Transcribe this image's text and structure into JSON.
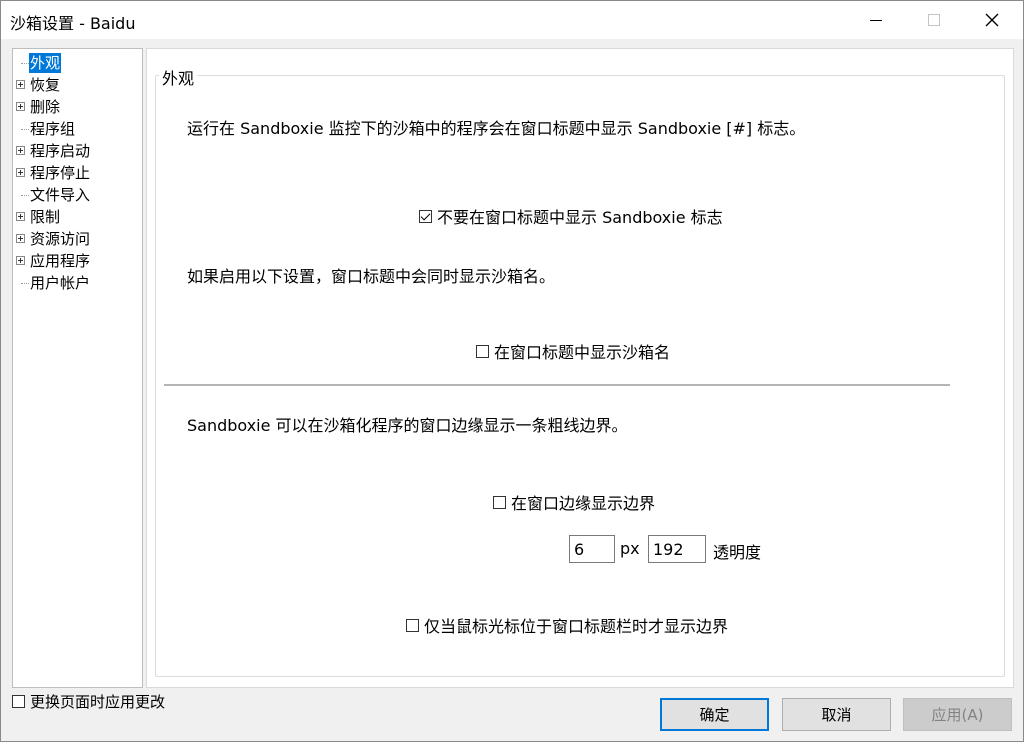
{
  "window": {
    "title": "沙箱设置 - Baidu"
  },
  "tree": {
    "items": [
      {
        "label": "外观",
        "expandable": false,
        "selected": true
      },
      {
        "label": "恢复",
        "expandable": true,
        "selected": false
      },
      {
        "label": "删除",
        "expandable": true,
        "selected": false
      },
      {
        "label": "程序组",
        "expandable": false,
        "selected": false
      },
      {
        "label": "程序启动",
        "expandable": true,
        "selected": false
      },
      {
        "label": "程序停止",
        "expandable": true,
        "selected": false
      },
      {
        "label": "文件导入",
        "expandable": false,
        "selected": false
      },
      {
        "label": "限制",
        "expandable": true,
        "selected": false
      },
      {
        "label": "资源访问",
        "expandable": true,
        "selected": false
      },
      {
        "label": "应用程序",
        "expandable": true,
        "selected": false
      },
      {
        "label": "用户帐户",
        "expandable": false,
        "selected": false
      }
    ]
  },
  "panel": {
    "group_title": "外观",
    "desc_title_marker": "运行在 Sandboxie 监控下的沙箱中的程序会在窗口标题中显示 Sandboxie [#] 标志。",
    "chk_hide_marker": {
      "label": "不要在窗口标题中显示 Sandboxie 标志",
      "checked": true
    },
    "desc_box_name": "如果启用以下设置，窗口标题中会同时显示沙箱名。",
    "chk_show_box_name": {
      "label": "在窗口标题中显示沙箱名",
      "checked": false
    },
    "desc_border": "Sandboxie 可以在沙箱化程序的窗口边缘显示一条粗线边界。",
    "chk_show_border": {
      "label": "在窗口边缘显示边界",
      "checked": false
    },
    "border_width": "6",
    "border_width_unit": "px",
    "opacity_value": "192",
    "opacity_label": "透明度",
    "chk_border_on_hover": {
      "label": "仅当鼠标光标位于窗口标题栏时才显示边界",
      "checked": false
    }
  },
  "footer": {
    "apply_on_page_change": {
      "label": "更换页面时应用更改",
      "checked": false
    },
    "ok_label": "确定",
    "cancel_label": "取消",
    "apply_label": "应用(A)"
  }
}
